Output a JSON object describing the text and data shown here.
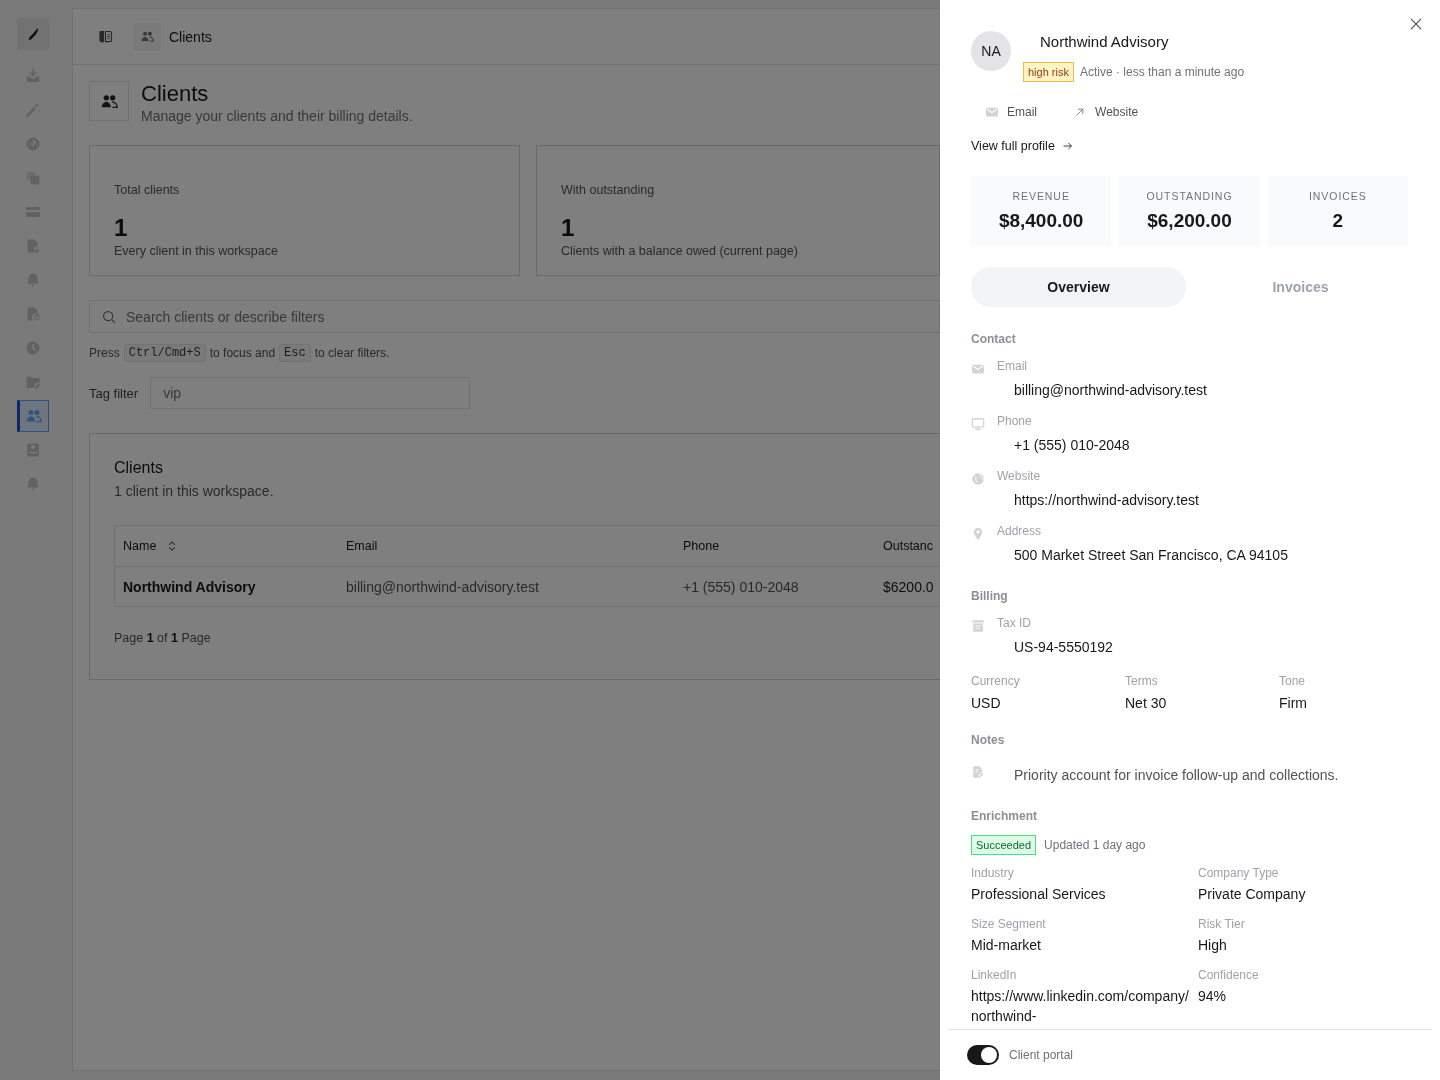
{
  "sidebar": {
    "items": [
      {
        "selected": false
      },
      {
        "selected": false
      },
      {
        "selected": false
      },
      {
        "selected": false
      },
      {
        "selected": false
      },
      {
        "selected": false
      },
      {
        "selected": false
      },
      {
        "selected": false
      },
      {
        "selected": false
      },
      {
        "selected": false
      },
      {
        "selected": true
      },
      {
        "selected": false
      },
      {
        "selected": false
      }
    ]
  },
  "header": {
    "breadcrumb": "Clients"
  },
  "page": {
    "title": "Clients",
    "subtitle": "Manage your clients and their billing details."
  },
  "stats": [
    {
      "label": "Total clients",
      "value": "1",
      "description": "Every client in this workspace"
    },
    {
      "label": "With outstanding",
      "value": "1",
      "description": "Clients with a balance owed (current page)"
    }
  ],
  "search": {
    "placeholder": "Search clients or describe filters"
  },
  "shortcut_hint": [
    {
      "kind": "text",
      "text": "Press"
    },
    {
      "kind": "key",
      "text": "Ctrl/Cmd+S"
    },
    {
      "kind": "text",
      "text": "to focus and"
    },
    {
      "kind": "key",
      "text": "Esc"
    },
    {
      "kind": "text",
      "text": "to clear filters."
    }
  ],
  "tag_filter": {
    "label": "Tag filter",
    "placeholder": "vip"
  },
  "clients_table": {
    "title": "Clients",
    "subtitle": "1 client in this workspace.",
    "columns": [
      {
        "label": "Name",
        "kind": "name",
        "sortable": true
      },
      {
        "label": "Email",
        "kind": "text",
        "sortable": false
      },
      {
        "label": "Phone",
        "kind": "text",
        "sortable": false
      },
      {
        "label": "Outstanc",
        "kind": "amount",
        "sortable": false
      }
    ],
    "rows": [
      [
        "Northwind Advisory",
        "billing@northwind-advisory.test",
        "+1 (555) 010-2048",
        "$6200.0"
      ]
    ],
    "pagination": "Page **1** of **1** Page"
  },
  "drawer": {
    "avatar": "NA",
    "name": "Northwind Advisory",
    "badge": "high risk",
    "status": "Active · less than a minute ago",
    "actions": [
      {
        "kind": "email",
        "label": "Email"
      },
      {
        "kind": "website",
        "label": "Website"
      }
    ],
    "profile_link": "View full profile",
    "metrics": [
      {
        "label": "REVENUE",
        "value": "$8,400.00"
      },
      {
        "label": "OUTSTANDING",
        "value": "$6,200.00"
      },
      {
        "label": "INVOICES",
        "value": "2"
      }
    ],
    "tabs": [
      {
        "label": "Overview",
        "selected": true
      },
      {
        "label": "Invoices",
        "selected": false
      }
    ],
    "contact": {
      "title": "Contact",
      "items": [
        {
          "kind": "email",
          "label": "Email",
          "value": "billing@northwind-advisory.test"
        },
        {
          "kind": "phone",
          "label": "Phone",
          "value": "+1 (555) 010-2048"
        },
        {
          "kind": "website",
          "label": "Website",
          "value": "https://northwind-advisory.test"
        },
        {
          "kind": "address",
          "label": "Address",
          "value": "500 Market Street San Francisco, CA 94105"
        }
      ]
    },
    "billing": {
      "title": "Billing",
      "items": [
        {
          "kind": "tax_id",
          "label": "Tax ID",
          "value": "US-94-5550192"
        }
      ],
      "fields": [
        {
          "label": "Currency",
          "value": "USD"
        },
        {
          "label": "Terms",
          "value": "Net 30"
        },
        {
          "label": "Tone",
          "value": "Firm"
        }
      ]
    },
    "notes": {
      "title": "Notes",
      "text": "Priority account for invoice follow-up and collections."
    },
    "enrichment": {
      "title": "Enrichment",
      "status": "Succeeded",
      "updated": "Updated 1 day ago",
      "fields": [
        {
          "label": "Industry",
          "value": "Professional Services"
        },
        {
          "label": "Company Type",
          "value": "Private Company"
        },
        {
          "label": "Size Segment",
          "value": "Mid-market"
        },
        {
          "label": "Risk Tier",
          "value": "High"
        },
        {
          "label": "LinkedIn",
          "value": "https://www.linkedin.com/company/northwind-"
        },
        {
          "label": "Confidence",
          "value": "94%"
        }
      ]
    },
    "footer": {
      "toggle": {
        "label": "Client portal",
        "on": true
      }
    }
  }
}
